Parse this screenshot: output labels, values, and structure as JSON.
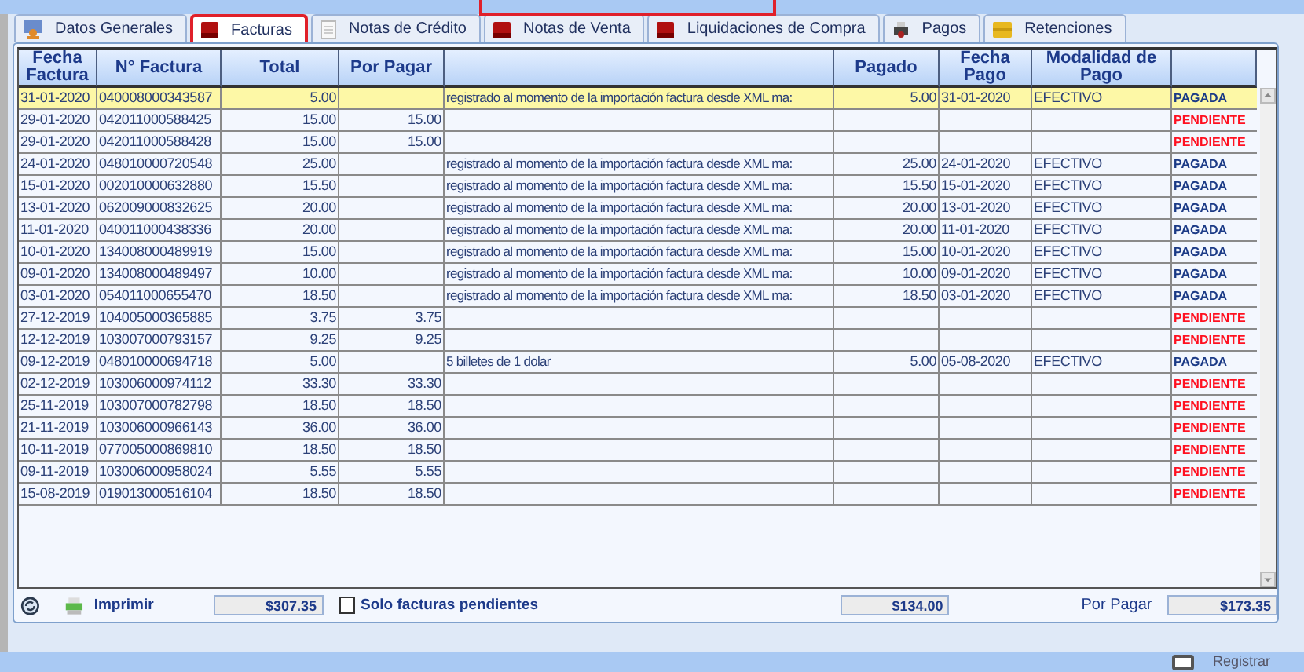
{
  "tabs": [
    {
      "label": "Datos Generales",
      "selected": false
    },
    {
      "label": "Facturas",
      "selected": true
    },
    {
      "label": "Notas de Crédito",
      "selected": false
    },
    {
      "label": "Notas de Venta",
      "selected": false
    },
    {
      "label": "Liquidaciones de Compra",
      "selected": false
    },
    {
      "label": "Pagos",
      "selected": false
    },
    {
      "label": "Retenciones",
      "selected": false
    }
  ],
  "table": {
    "columns": [
      "Fecha Factura",
      "N° Factura",
      "Total",
      "Por Pagar",
      "",
      "Pagado",
      "Fecha Pago",
      "Modalidad de Pago",
      ""
    ],
    "rows": [
      {
        "selected": true,
        "paid": true,
        "cells": [
          "31-01-2020",
          "040008000343587",
          "5.00",
          "",
          "registrado al momento de la importación  factura desde XML ma:",
          "5.00",
          "31-01-2020",
          "EFECTIVO",
          "PAGADA"
        ]
      },
      {
        "selected": false,
        "paid": false,
        "cells": [
          "29-01-2020",
          "042011000588425",
          "15.00",
          "15.00",
          "",
          "",
          "",
          "",
          "PENDIENTE"
        ]
      },
      {
        "selected": false,
        "paid": false,
        "cells": [
          "29-01-2020",
          "042011000588428",
          "15.00",
          "15.00",
          "",
          "",
          "",
          "",
          "PENDIENTE"
        ]
      },
      {
        "selected": false,
        "paid": true,
        "cells": [
          "24-01-2020",
          "048010000720548",
          "25.00",
          "",
          "registrado al momento de la importación  factura desde XML ma:",
          "25.00",
          "24-01-2020",
          "EFECTIVO",
          "PAGADA"
        ]
      },
      {
        "selected": false,
        "paid": true,
        "cells": [
          "15-01-2020",
          "002010000632880",
          "15.50",
          "",
          "registrado al momento de la importación  factura desde XML ma:",
          "15.50",
          "15-01-2020",
          "EFECTIVO",
          "PAGADA"
        ]
      },
      {
        "selected": false,
        "paid": true,
        "cells": [
          "13-01-2020",
          "062009000832625",
          "20.00",
          "",
          "registrado al momento de la importación  factura desde XML ma:",
          "20.00",
          "13-01-2020",
          "EFECTIVO",
          "PAGADA"
        ]
      },
      {
        "selected": false,
        "paid": true,
        "cells": [
          "11-01-2020",
          "040011000438336",
          "20.00",
          "",
          "registrado al momento de la importación  factura desde XML ma:",
          "20.00",
          "11-01-2020",
          "EFECTIVO",
          "PAGADA"
        ]
      },
      {
        "selected": false,
        "paid": true,
        "cells": [
          "10-01-2020",
          "134008000489919",
          "15.00",
          "",
          "registrado al momento de la importación  factura desde XML ma:",
          "15.00",
          "10-01-2020",
          "EFECTIVO",
          "PAGADA"
        ]
      },
      {
        "selected": false,
        "paid": true,
        "cells": [
          "09-01-2020",
          "134008000489497",
          "10.00",
          "",
          "registrado al momento de la importación  factura desde XML ma:",
          "10.00",
          "09-01-2020",
          "EFECTIVO",
          "PAGADA"
        ]
      },
      {
        "selected": false,
        "paid": true,
        "cells": [
          "03-01-2020",
          "054011000655470",
          "18.50",
          "",
          "registrado al momento de la importación  factura desde XML ma:",
          "18.50",
          "03-01-2020",
          "EFECTIVO",
          "PAGADA"
        ]
      },
      {
        "selected": false,
        "paid": false,
        "cells": [
          "27-12-2019",
          "104005000365885",
          "3.75",
          "3.75",
          "",
          "",
          "",
          "",
          "PENDIENTE"
        ]
      },
      {
        "selected": false,
        "paid": false,
        "cells": [
          "12-12-2019",
          "103007000793157",
          "9.25",
          "9.25",
          "",
          "",
          "",
          "",
          "PENDIENTE"
        ]
      },
      {
        "selected": false,
        "paid": true,
        "cells": [
          "09-12-2019",
          "048010000694718",
          "5.00",
          "",
          "5 billetes de 1 dolar",
          "5.00",
          "05-08-2020",
          "EFECTIVO",
          "PAGADA"
        ]
      },
      {
        "selected": false,
        "paid": false,
        "cells": [
          "02-12-2019",
          "103006000974112",
          "33.30",
          "33.30",
          "",
          "",
          "",
          "",
          "PENDIENTE"
        ]
      },
      {
        "selected": false,
        "paid": false,
        "cells": [
          "25-11-2019",
          "103007000782798",
          "18.50",
          "18.50",
          "",
          "",
          "",
          "",
          "PENDIENTE"
        ]
      },
      {
        "selected": false,
        "paid": false,
        "cells": [
          "21-11-2019",
          "103006000966143",
          "36.00",
          "36.00",
          "",
          "",
          "",
          "",
          "PENDIENTE"
        ]
      },
      {
        "selected": false,
        "paid": false,
        "cells": [
          "10-11-2019",
          "077005000869810",
          "18.50",
          "18.50",
          "",
          "",
          "",
          "",
          "PENDIENTE"
        ]
      },
      {
        "selected": false,
        "paid": false,
        "cells": [
          "09-11-2019",
          "103006000958024",
          "5.55",
          "5.55",
          "",
          "",
          "",
          "",
          "PENDIENTE"
        ]
      },
      {
        "selected": false,
        "paid": false,
        "cells": [
          "15-08-2019",
          "019013000516104",
          "18.50",
          "18.50",
          "",
          "",
          "",
          "",
          "PENDIENTE"
        ]
      }
    ]
  },
  "footer": {
    "print_label": "Imprimir",
    "total": "$307.35",
    "only_pending": {
      "label": "Solo facturas pendientes",
      "checked": false
    },
    "paid_total": "$134.00",
    "due_label": "Por Pagar",
    "due_total": "$173.35"
  },
  "bottom_bar": {
    "register_label": "Registrar",
    "register_checked": false
  }
}
